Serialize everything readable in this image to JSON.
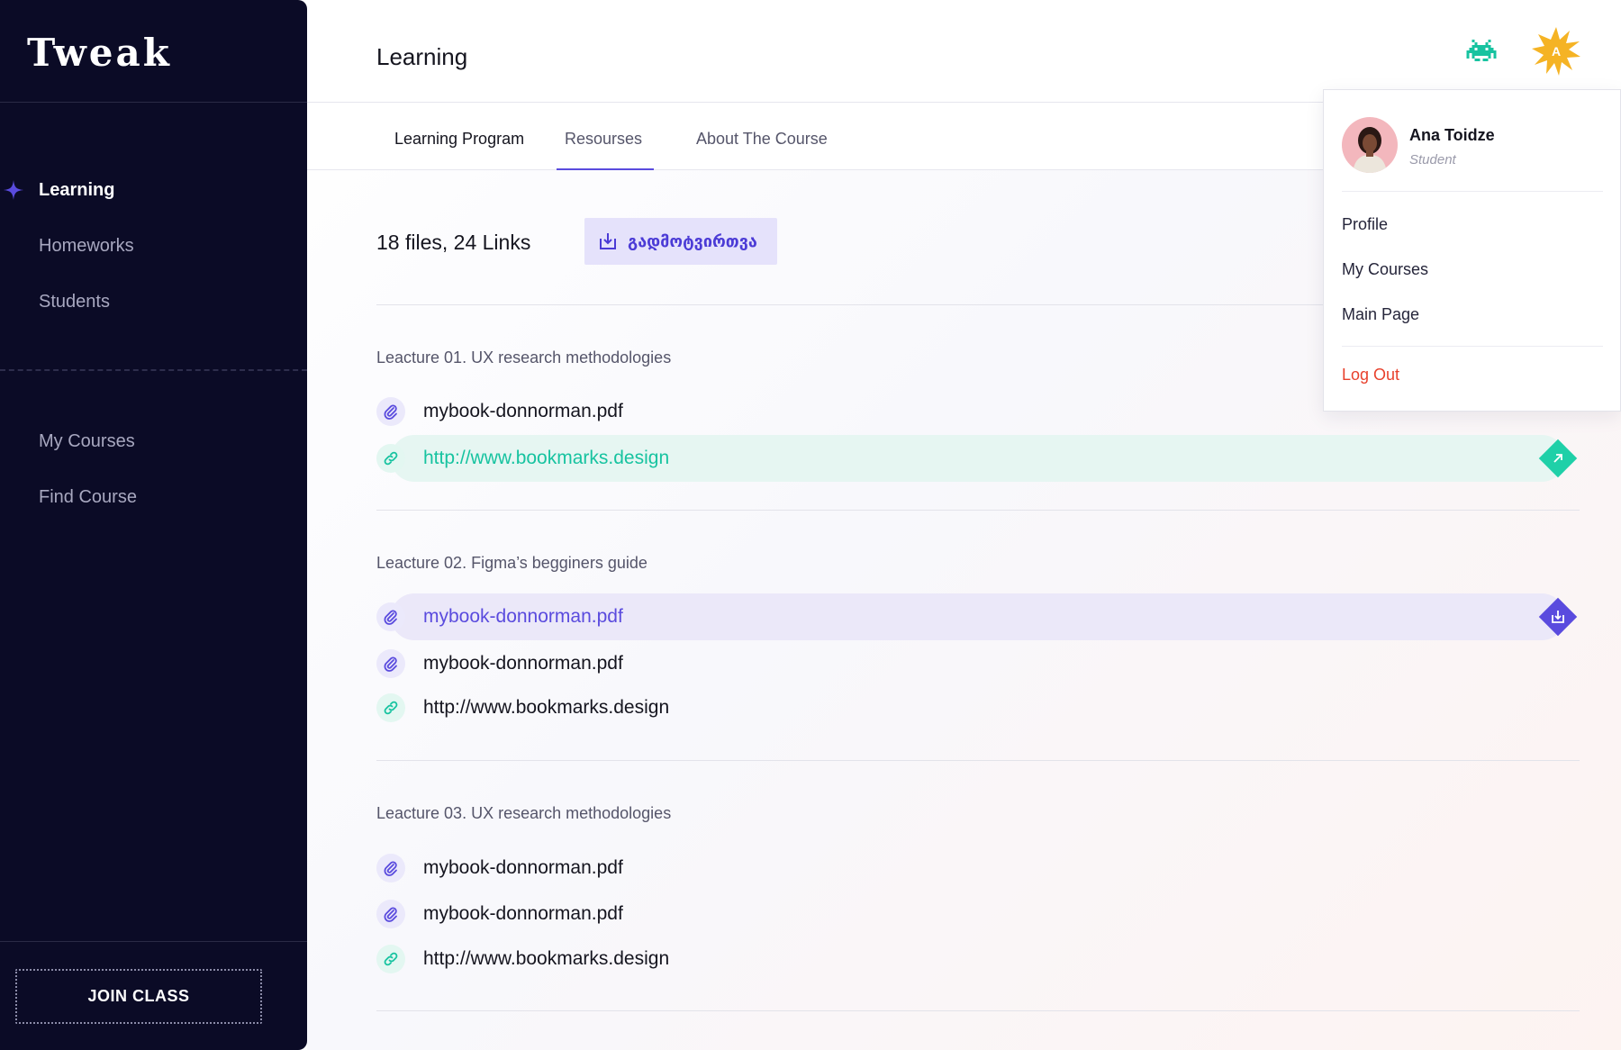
{
  "sidebar": {
    "logo": "Tweak",
    "items": [
      {
        "label": "Learning"
      },
      {
        "label": "Homeworks"
      },
      {
        "label": "Students"
      }
    ],
    "items2": [
      {
        "label": "My Courses"
      },
      {
        "label": "Find Course"
      }
    ],
    "join_label": "JOIN CLASS"
  },
  "header": {
    "title": "Learning",
    "avatar_initial": "A"
  },
  "tabs": [
    {
      "label": "Learning Program"
    },
    {
      "label": "Resourses"
    },
    {
      "label": "About The Course"
    }
  ],
  "resources": {
    "summary": "18 files, 24 Links",
    "download_label": "გადმოტვირთვა"
  },
  "lectures": [
    {
      "title": "Leacture 01. UX research methodologies",
      "items": [
        {
          "text": "mybook-donnorman.pdf"
        },
        {
          "text": "http://www.bookmarks.design"
        }
      ]
    },
    {
      "title": "Leacture 02. Figma’s begginers guide",
      "items": [
        {
          "text": "mybook-donnorman.pdf"
        },
        {
          "text": "mybook-donnorman.pdf"
        },
        {
          "text": "http://www.bookmarks.design"
        }
      ]
    },
    {
      "title": "Leacture 03. UX research methodologies",
      "items": [
        {
          "text": "mybook-donnorman.pdf"
        },
        {
          "text": "mybook-donnorman.pdf"
        },
        {
          "text": "http://www.bookmarks.design"
        }
      ]
    }
  ],
  "dropdown": {
    "name": "Ana Toidze",
    "role": "Student",
    "items": [
      {
        "label": "Profile"
      },
      {
        "label": "My Courses"
      },
      {
        "label": "Main Page"
      }
    ],
    "logout": "Log Out"
  },
  "colors": {
    "sidebar_bg": "#0b0b26",
    "accent_purple": "#5a4bde",
    "accent_teal": "#17c3a0",
    "avatar_star": "#f5b324",
    "logout_red": "#e8412d"
  },
  "icons": {
    "header_game": "space-invader-icon",
    "file": "paperclip-icon",
    "link": "chain-link-icon",
    "open": "arrow-up-right-icon",
    "download": "download-icon"
  }
}
